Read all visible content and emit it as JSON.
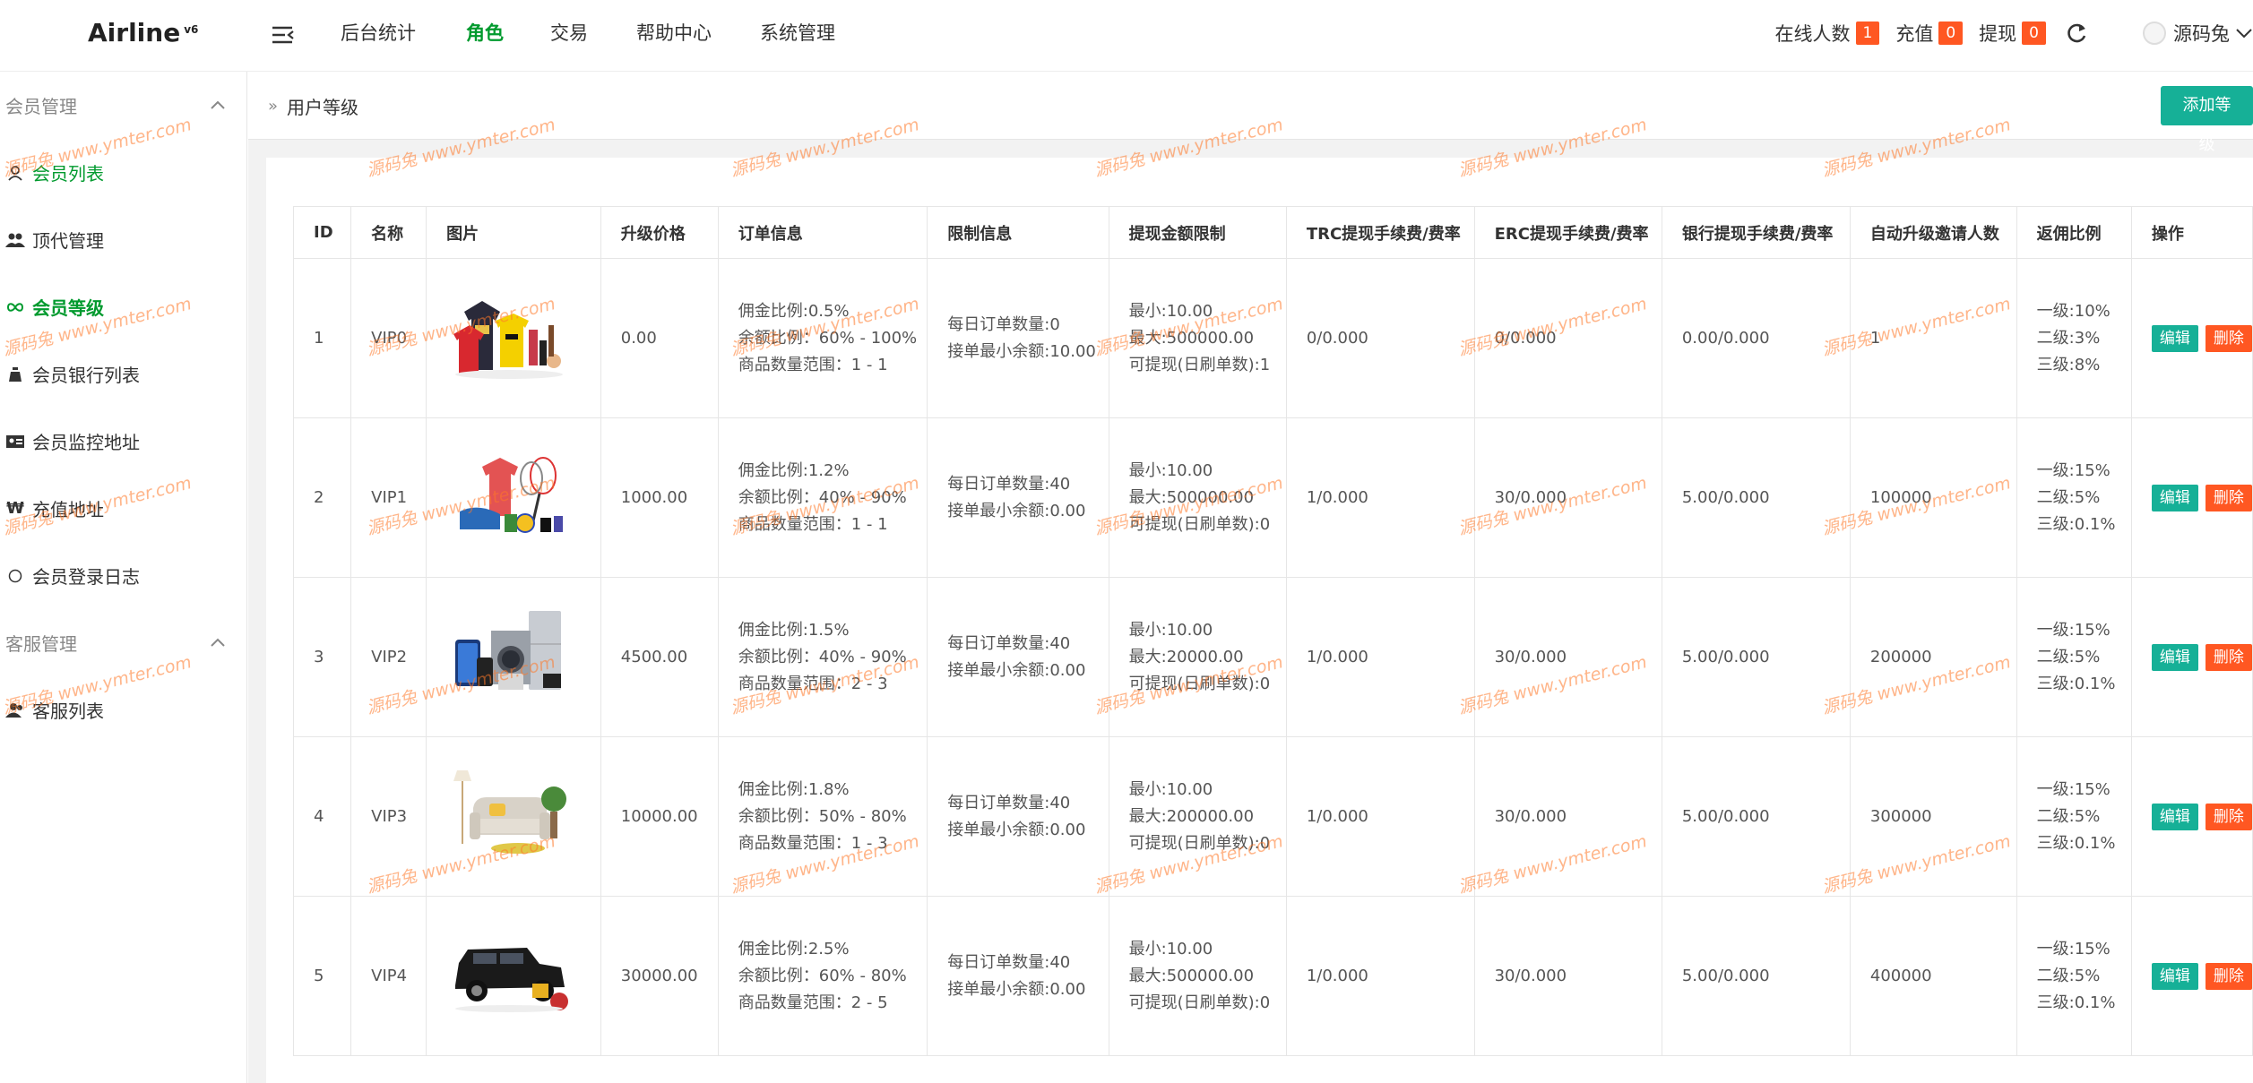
{
  "header": {
    "logo": "Airline",
    "logo_version": "v6",
    "nav": [
      "后台统计",
      "角色",
      "交易",
      "帮助中心",
      "系统管理"
    ],
    "nav_active_index": 1,
    "online_label": "在线人数",
    "online_count": "1",
    "recharge_label": "充值",
    "recharge_count": "0",
    "withdraw_label": "提现",
    "withdraw_count": "0",
    "username": "源码兔"
  },
  "sidebar": {
    "groups": [
      {
        "title": "会员管理",
        "items": [
          "会员列表",
          "顶代管理",
          "会员等级",
          "会员银行列表",
          "会员监控地址",
          "充值地址",
          "会员登录日志"
        ]
      },
      {
        "title": "客服管理",
        "items": [
          "客服列表"
        ]
      }
    ],
    "active_item": "会员等级"
  },
  "breadcrumb": {
    "current": "用户等级",
    "add_button": "添加等级"
  },
  "table": {
    "headers": [
      "ID",
      "名称",
      "图片",
      "升级价格",
      "订单信息",
      "限制信息",
      "提现金额限制",
      "TRC提现手续费/费率",
      "ERC提现手续费/费率",
      "银行提现手续费/费率",
      "自动升级邀请人数",
      "返佣比例",
      "操作"
    ],
    "edit_label": "编辑",
    "delete_label": "删除",
    "rows": [
      {
        "id": "1",
        "name": "VIP0",
        "image": "clothing-cosmetics-bundle",
        "price": "0.00",
        "order": [
          "佣金比例:0.5%",
          "余额比例：60% - 100%",
          "商品数量范围：1 - 1"
        ],
        "limit": [
          "每日订单数量:0",
          "接单最小余额:10.00"
        ],
        "withdraw": [
          "最小:10.00",
          "最大:500000.00",
          "可提现(日刷单数):1"
        ],
        "trc": "0/0.000",
        "erc": "0/0.000",
        "bank": "0.00/0.000",
        "invite": "1",
        "rebate": [
          "一级:10%",
          "二级:3%",
          "三级:8%"
        ]
      },
      {
        "id": "2",
        "name": "VIP1",
        "image": "sports-goods-bundle",
        "price": "1000.00",
        "order": [
          "佣金比例:1.2%",
          "余额比例：40% - 90%",
          "商品数量范围：1 - 1"
        ],
        "limit": [
          "每日订单数量:40",
          "接单最小余额:0.00"
        ],
        "withdraw": [
          "最小:10.00",
          "最大:500000.00",
          "可提现(日刷单数):0"
        ],
        "trc": "1/0.000",
        "erc": "30/0.000",
        "bank": "5.00/0.000",
        "invite": "100000",
        "rebate": [
          "一级:15%",
          "二级:5%",
          "三级:0.1%"
        ]
      },
      {
        "id": "3",
        "name": "VIP2",
        "image": "electronics-appliances-bundle",
        "price": "4500.00",
        "order": [
          "佣金比例:1.5%",
          "余额比例：40% - 90%",
          "商品数量范围：2 - 3"
        ],
        "limit": [
          "每日订单数量:40",
          "接单最小余额:0.00"
        ],
        "withdraw": [
          "最小:10.00",
          "最大:20000.00",
          "可提现(日刷单数):0"
        ],
        "trc": "1/0.000",
        "erc": "30/0.000",
        "bank": "5.00/0.000",
        "invite": "200000",
        "rebate": [
          "一级:15%",
          "二级:5%",
          "三级:0.1%"
        ]
      },
      {
        "id": "4",
        "name": "VIP3",
        "image": "sofa-furniture",
        "price": "10000.00",
        "order": [
          "佣金比例:1.8%",
          "余额比例：50% - 80%",
          "商品数量范围：1 - 3"
        ],
        "limit": [
          "每日订单数量:40",
          "接单最小余额:0.00"
        ],
        "withdraw": [
          "最小:10.00",
          "最大:200000.00",
          "可提现(日刷单数):0"
        ],
        "trc": "1/0.000",
        "erc": "30/0.000",
        "bank": "5.00/0.000",
        "invite": "300000",
        "rebate": [
          "一级:15%",
          "二级:5%",
          "三级:0.1%"
        ]
      },
      {
        "id": "5",
        "name": "VIP4",
        "image": "suv-car",
        "price": "30000.00",
        "order": [
          "佣金比例:2.5%",
          "余额比例：60% - 80%",
          "商品数量范围：2 - 5"
        ],
        "limit": [
          "每日订单数量:40",
          "接单最小余额:0.00"
        ],
        "withdraw": [
          "最小:10.00",
          "最大:500000.00",
          "可提现(日刷单数):0"
        ],
        "trc": "1/0.000",
        "erc": "30/0.000",
        "bank": "5.00/0.000",
        "invite": "400000",
        "rebate": [
          "一级:15%",
          "二级:5%",
          "三级:0.1%"
        ]
      }
    ]
  },
  "watermark": "源码兔 www.ymter.com",
  "colors": {
    "accent_green": "#009a2e",
    "teal": "#16b097",
    "danger": "#ff5722"
  }
}
